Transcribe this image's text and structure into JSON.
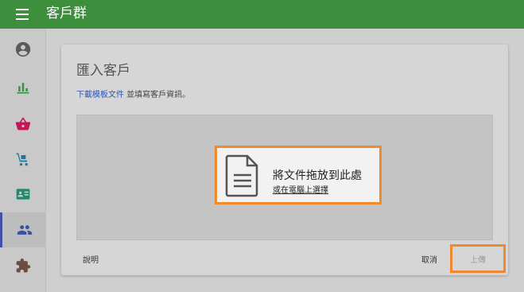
{
  "app": {
    "title": "客戶群"
  },
  "sidebar": {
    "items": [
      {
        "name": "account",
        "icon": "account-circle-icon"
      },
      {
        "name": "reports",
        "icon": "bar-chart-icon"
      },
      {
        "name": "shop",
        "icon": "basket-icon"
      },
      {
        "name": "delivery",
        "icon": "hand-truck-icon"
      },
      {
        "name": "contact-card",
        "icon": "contact-card-icon"
      },
      {
        "name": "customers",
        "icon": "people-icon",
        "active": true
      },
      {
        "name": "extensions",
        "icon": "puzzle-icon"
      }
    ]
  },
  "import": {
    "title": "匯入客戶",
    "download_link": "下載模板文件",
    "instruction": " 並填寫客戶資訊。",
    "drop_main": "將文件拖放到此處",
    "drop_sub": "或在電腦上選擇",
    "help": "說明",
    "cancel": "取消",
    "upload": "上傳"
  },
  "colors": {
    "topbar": "#3d8f3d",
    "active_indicator": "#4450a8",
    "highlight_border": "#f08a2e",
    "link": "#2d55b0"
  }
}
